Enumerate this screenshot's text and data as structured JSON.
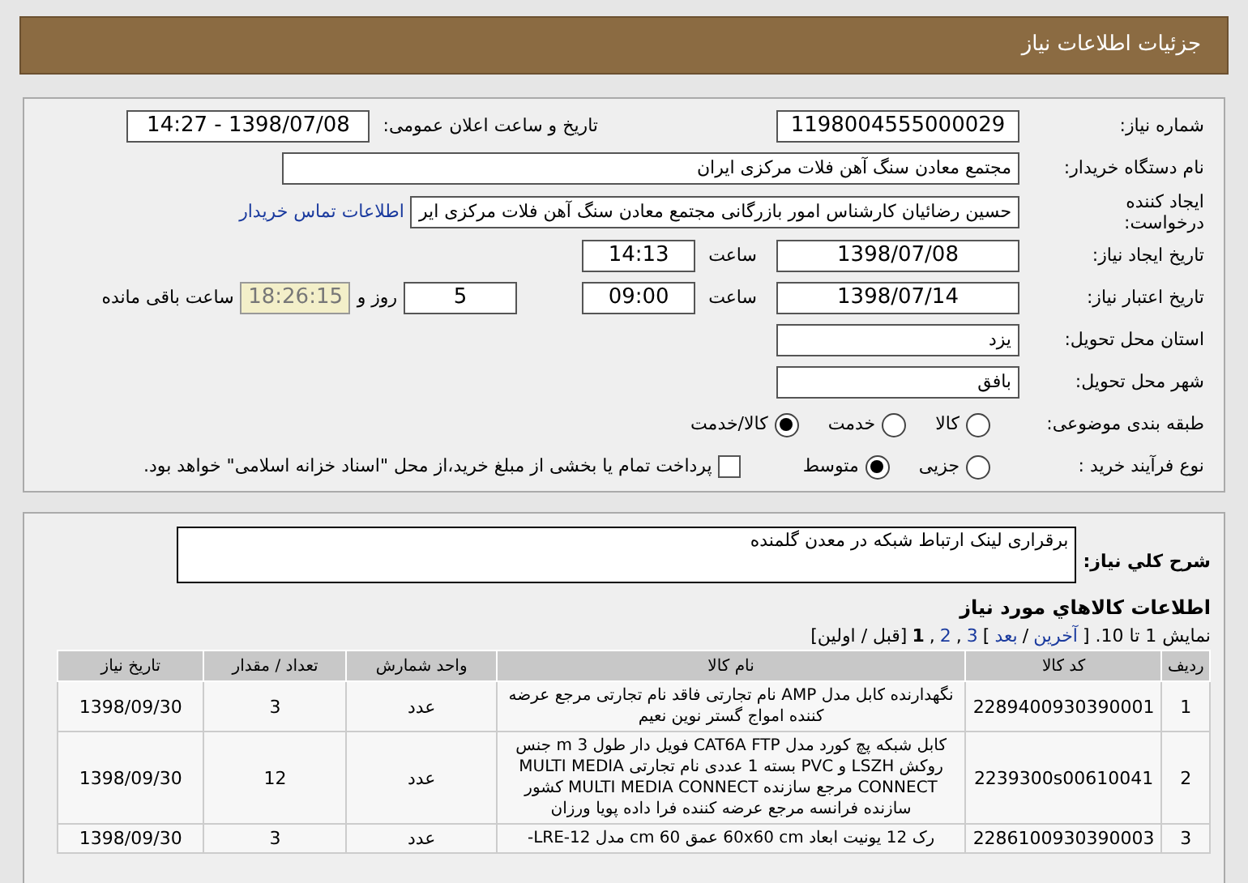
{
  "header": {
    "title": "جزئیات اطلاعات نیاز"
  },
  "need_number": {
    "label": "شماره نیاز:",
    "value": "1198004555000029"
  },
  "announce": {
    "label": "تاریخ و ساعت اعلان عمومی:",
    "value": "1398/07/08 - 14:27"
  },
  "buyer": {
    "label": "نام دستگاه خریدار:",
    "value": "مجتمع معادن سنگ آهن فلات مرکزی ایران"
  },
  "creator": {
    "label_lines": [
      "ایجاد کننده",
      "درخواست:"
    ],
    "value": "حسین رضائیان کارشناس امور بازرگانی مجتمع معادن سنگ آهن فلات مرکزی ایر",
    "link": "اطلاعات تماس خریدار"
  },
  "creation": {
    "label": "تاریخ ایجاد نیاز:",
    "date": "1398/07/08",
    "time_label": "ساعت",
    "time": "14:13"
  },
  "validity": {
    "label": "تاریخ اعتبار نیاز:",
    "date": "1398/07/14",
    "time_label": "ساعت",
    "time": "09:00",
    "days": "5",
    "days_label": "روز و",
    "remaining": "18:26:15",
    "remaining_label": "ساعت باقی مانده"
  },
  "province": {
    "label": "استان محل تحویل:",
    "value": "یزد"
  },
  "city": {
    "label": "شهر محل تحویل:",
    "value": "بافق"
  },
  "category": {
    "label": "طبقه بندی موضوعی:",
    "options": [
      {
        "label": "کالا",
        "selected": false
      },
      {
        "label": "خدمت",
        "selected": false
      },
      {
        "label": "کالا/خدمت",
        "selected": true
      }
    ]
  },
  "purchase_type": {
    "label": "نوع فرآیند خرید :",
    "options": [
      {
        "label": "جزیی",
        "selected": false
      },
      {
        "label": "متوسط",
        "selected": true
      }
    ],
    "treasury": {
      "checked": false,
      "label": "پرداخت تمام یا بخشی از مبلغ خرید،از محل \"اسناد خزانه اسلامی\" خواهد بود."
    }
  },
  "description": {
    "label": "شرح کلي نياز:",
    "value": "برقراری لینک ارتباط شبکه در معدن گلمنده"
  },
  "items": {
    "title": "اطلاعات کالاهاي مورد نياز",
    "pagination": [
      {
        "kind": "text",
        "text": "نمایش 1 تا 10. ["
      },
      {
        "kind": "link",
        "text": "آخرین"
      },
      {
        "kind": "text",
        "text": "/"
      },
      {
        "kind": "link",
        "text": "بعد"
      },
      {
        "kind": "text",
        "text": "]"
      },
      {
        "kind": "link",
        "text": "3"
      },
      {
        "kind": "text",
        "text": ","
      },
      {
        "kind": "link",
        "text": "2"
      },
      {
        "kind": "text",
        "text": ","
      },
      {
        "kind": "current",
        "text": "1"
      },
      {
        "kind": "text",
        "text": "[قبل / اولین]"
      }
    ],
    "columns": [
      "ردیف",
      "کد کالا",
      "نام کالا",
      "واحد شمارش",
      "تعداد / مقدار",
      "تاریخ نیاز"
    ],
    "rows": [
      {
        "index": "1",
        "code": "2289400930390001",
        "name": "نگهدارنده کابل مدل AMP نام تجارتی فاقد نام تجارتی مرجع عرضه کننده امواج گستر نوین نعیم",
        "unit": "عدد",
        "qty": "3",
        "date": "1398/09/30"
      },
      {
        "index": "2",
        "code": "2239300s00610041",
        "name": "کابل شبکه پچ کورد مدل CAT6A FTP فویل دار طول 3 m جنس روکش LSZH و PVC بسته 1 عددی نام تجارتی MULTI MEDIA CONNECT مرجع سازنده MULTI MEDIA CONNECT کشور سازنده فرانسه مرجع عرضه کننده فرا داده پویا ورزان",
        "unit": "عدد",
        "qty": "12",
        "date": "1398/09/30"
      },
      {
        "index": "3",
        "code": "2286100930390003",
        "name": "رک 12 یونیت ابعاد 60x60 cm عمق 60 cm مدل LRE-12-",
        "unit": "عدد",
        "qty": "3",
        "date": "1398/09/30"
      }
    ]
  }
}
